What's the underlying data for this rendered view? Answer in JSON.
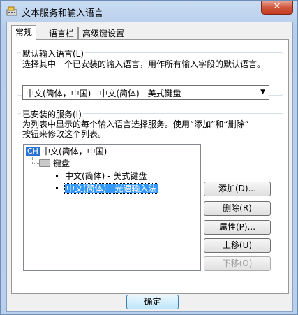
{
  "window": {
    "title": "文本服务和输入语言",
    "close_label": "✕"
  },
  "tabs": [
    {
      "label": "常规",
      "active": true
    },
    {
      "label": "语言栏",
      "active": false
    },
    {
      "label": "高级键设置",
      "active": false
    }
  ],
  "default_language": {
    "group_label": "默认输入语言(L)",
    "description": "选择其中一个已安装的输入语言，用作所有输入字段的默认语言。",
    "selected_value": "中文(简体，中国) - 中文(简体) - 美式键盘"
  },
  "installed_services": {
    "group_label": "已安装的服务(I)",
    "description_line1": "为列表中显示的每个输入语言选择服务。使用“添加”和“删除”",
    "description_line2": "按钮来修改这个列表。",
    "tree": {
      "language_badge": "CH",
      "language_label": "中文(简体，中国)",
      "category_label": "键盘",
      "items": [
        {
          "label": "中文(简体) - 美式键盘",
          "selected": false
        },
        {
          "label": "中文(简体) - 光速输入法",
          "selected": true
        }
      ]
    }
  },
  "buttons": {
    "add": "添加(D)...",
    "remove": "删除(R)",
    "properties": "属性(P)...",
    "move_up": "上移(U)",
    "move_down": "下移(O)"
  },
  "footer": {
    "ok": "确定"
  }
}
